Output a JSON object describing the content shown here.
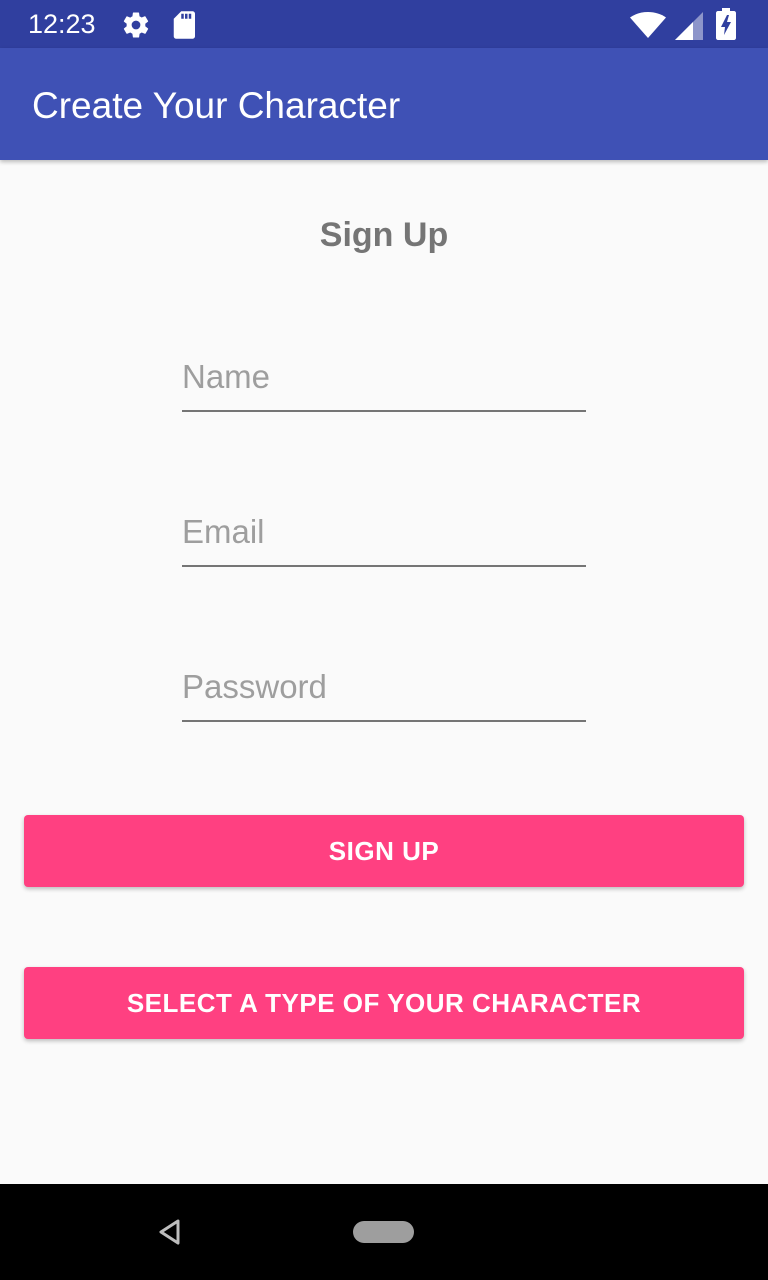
{
  "status_bar": {
    "time": "12:23",
    "icons": [
      "gear-icon",
      "sd-card-icon",
      "wifi-icon",
      "signal-icon",
      "battery-charging-icon"
    ]
  },
  "app_bar": {
    "title": "Create Your Character"
  },
  "form": {
    "heading": "Sign Up",
    "name_placeholder": "Name",
    "email_placeholder": "Email",
    "password_placeholder": "Password",
    "name_value": "",
    "email_value": "",
    "password_value": ""
  },
  "buttons": {
    "sign_up": "SIGN UP",
    "select_type": "SELECT A TYPE OF YOUR CHARACTER"
  },
  "nav_bar": {
    "icons": [
      "back-icon",
      "home-pill-icon"
    ]
  },
  "colors": {
    "status_bar": "#303f9f",
    "app_bar": "#3f51b5",
    "accent": "#ff4081",
    "background": "#fafafa",
    "heading_text": "#757575"
  }
}
